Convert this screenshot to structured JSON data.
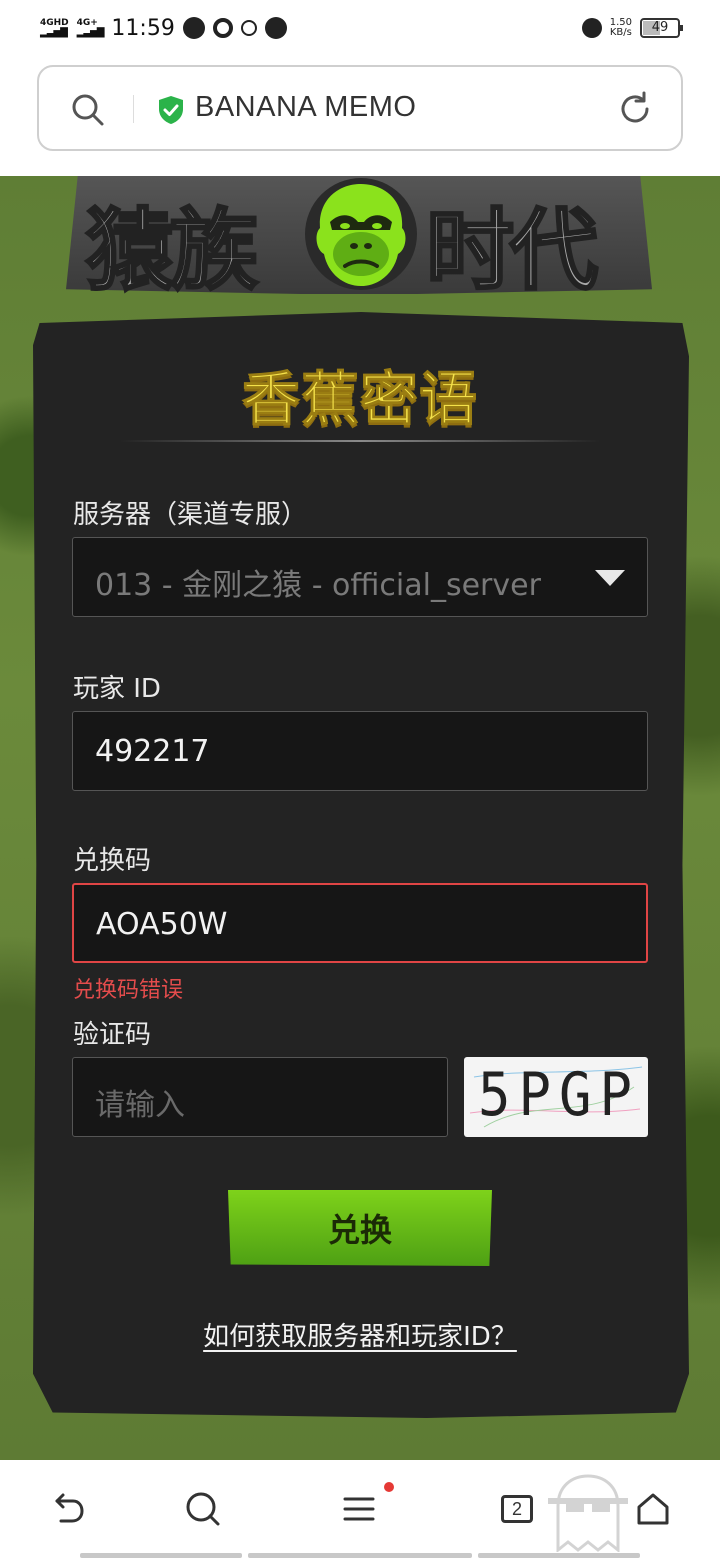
{
  "status_bar": {
    "network_1": "4GHD",
    "network_2": "4G+",
    "time": "11:59",
    "speed_value": "1.50",
    "speed_unit": "KB/s",
    "battery": "49",
    "battery_level": 0.49
  },
  "address_bar": {
    "title": "BANANA MEMO",
    "secure_color": "#2bb34a"
  },
  "game": {
    "logo_left": "猿族",
    "logo_right": "时代",
    "accent_color": "#8be21c"
  },
  "panel": {
    "title": "香蕉密语",
    "server_label": "服务器（渠道专服）",
    "server_value": "013 - 金刚之猿 - official_server",
    "player_label": "玩家 ID",
    "player_value": "492217",
    "code_label": "兑换码",
    "code_value": "AOA50W",
    "code_error": "兑换码错误",
    "captcha_label": "验证码",
    "captcha_placeholder": "请输入",
    "captcha_image_text": "5PGP",
    "submit_label": "兑换",
    "help_link": "如何获取服务器和玩家ID？"
  },
  "bottom_nav": {
    "tabs_count": "2",
    "icons": [
      "back-icon",
      "search-icon",
      "menu-icon",
      "tabs-icon",
      "ghost-icon",
      "home-icon"
    ]
  }
}
